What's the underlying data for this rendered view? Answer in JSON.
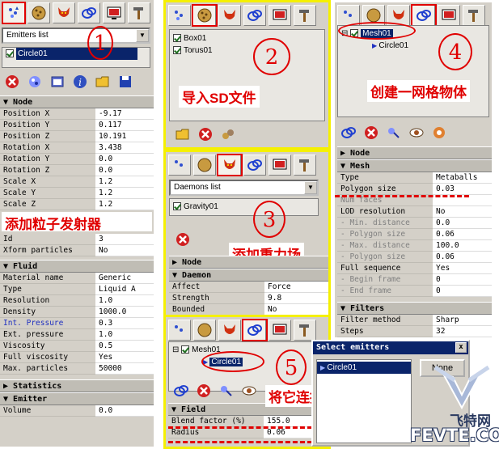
{
  "panel1": {
    "combo": "Emitters list",
    "items": [
      "Circle01"
    ],
    "number": "1",
    "node_header": "Node",
    "node_rows": [
      {
        "k": "Position X",
        "v": "-9.17"
      },
      {
        "k": "Position Y",
        "v": "0.117"
      },
      {
        "k": "Position Z",
        "v": "10.191"
      },
      {
        "k": "Rotation X",
        "v": "3.438"
      },
      {
        "k": "Rotation Y",
        "v": "0.0"
      },
      {
        "k": "Rotation Z",
        "v": "0.0"
      },
      {
        "k": "Scale X",
        "v": "1.2"
      },
      {
        "k": "Scale Y",
        "v": "1.2"
      },
      {
        "k": "Scale Z",
        "v": "1.2"
      }
    ],
    "anno": "添加粒子发射器",
    "id_rows": [
      {
        "k": "Id",
        "v": "3"
      },
      {
        "k": "Xform particles",
        "v": "No"
      }
    ],
    "fluid_header": "Fluid",
    "fluid_rows": [
      {
        "k": "Material name",
        "v": "Generic"
      },
      {
        "k": "Type",
        "v": "Liquid A"
      },
      {
        "k": "Resolution",
        "v": "1.0"
      },
      {
        "k": "Density",
        "v": "1000.0"
      },
      {
        "k": "Int. Pressure",
        "v": "0.3"
      },
      {
        "k": "Ext. pressure",
        "v": "1.0"
      },
      {
        "k": "Viscosity",
        "v": "0.5"
      },
      {
        "k": "Full viscosity",
        "v": "Yes"
      },
      {
        "k": "Max. particles",
        "v": "50000"
      }
    ],
    "stats_header": "Statistics",
    "emitter_header": "Emitter",
    "emitter_rows": [
      {
        "k": "Volume",
        "v": "0.0"
      }
    ]
  },
  "panel2": {
    "items": [
      "Box01",
      "Torus01"
    ],
    "number": "2",
    "anno": "导入SD文件"
  },
  "panel3": {
    "combo": "Daemons list",
    "items": [
      "Gravity01"
    ],
    "number": "3",
    "anno": "添加重力场",
    "node_header": "Node",
    "daemon_header": "Daemon",
    "rows": [
      {
        "k": "Affect",
        "v": "Force"
      },
      {
        "k": "Strength",
        "v": "9.8"
      },
      {
        "k": "Bounded",
        "v": "No"
      }
    ]
  },
  "panel4": {
    "tree_parent": "Mesh01",
    "tree_child": "Circle01",
    "number": "4",
    "anno": "创建一网格物体",
    "node_header": "Node",
    "mesh_header": "Mesh",
    "mesh_rows": [
      {
        "k": "Type",
        "v": "Metaballs"
      },
      {
        "k": "Polygon size",
        "v": "0.03"
      },
      {
        "k": "Num faces",
        "v": ""
      },
      {
        "k": "LOD resolution",
        "v": "No"
      },
      {
        "k": "- Min. distance",
        "v": "0.0"
      },
      {
        "k": "- Polygon size",
        "v": "0.06"
      },
      {
        "k": "- Max. distance",
        "v": "100.0"
      },
      {
        "k": "- Polygon size",
        "v": "0.06"
      },
      {
        "k": "Full sequence",
        "v": "Yes"
      },
      {
        "k": "- Begin frame",
        "v": "0"
      },
      {
        "k": "- End frame",
        "v": "0"
      }
    ],
    "filters_header": "Filters",
    "filter_rows": [
      {
        "k": "Filter method",
        "v": "Sharp"
      },
      {
        "k": "Steps",
        "v": "32"
      }
    ]
  },
  "panel5": {
    "tree_parent": "Mesh01",
    "tree_child": "Circle01",
    "number": "5",
    "anno": "将它连接到粒子发射器",
    "field_header": "Field",
    "rows": [
      {
        "k": "Blend factor (%)",
        "v": "155.0"
      },
      {
        "k": "Radius",
        "v": "0.06"
      }
    ]
  },
  "dialog": {
    "title": "Select emitters",
    "item": "Circle01",
    "none_button": "None",
    "close": "x"
  },
  "watermark": {
    "cn": "飞特网",
    "en": "FEVTE.COM"
  },
  "colors": {
    "panel": "#d4d0c8",
    "highlight": "#0a246a",
    "annotation": "#e00000",
    "frame": "#f5f000"
  }
}
